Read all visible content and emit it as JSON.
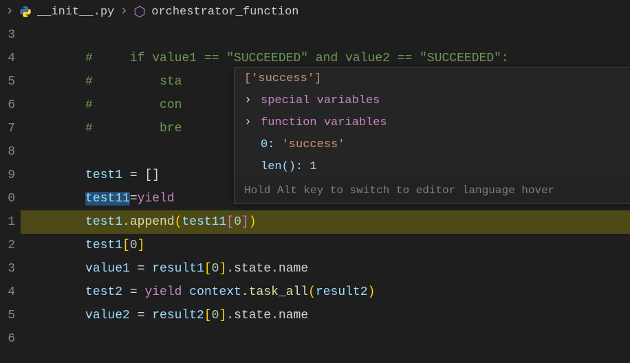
{
  "breadcrumb": {
    "file": "__init__.py",
    "symbol": "orchestrator_function"
  },
  "lines": {
    "l3": "",
    "l4_prefix": "#     ",
    "l4_code": "if value1 == \"SUCCEEDED\" and value2 == \"SUCCEEDED\":",
    "l5_prefix": "#         ",
    "l5_code": "sta",
    "l6_prefix": "#         ",
    "l6_code": "con",
    "l7_prefix": "#         ",
    "l7_code": "bre",
    "l8": "",
    "l9_var": "test1",
    "l9_rest": " = []",
    "l10_sel": "test11",
    "l10_eq": "=",
    "l10_kw": "yield ",
    "l11_a": "test1",
    "l11_dot": ".",
    "l11_fn": "append",
    "l11_po": "(",
    "l11_arg": "test11",
    "l11_bo": "[",
    "l11_idx": "0",
    "l11_bc": "]",
    "l11_pc": ")",
    "l12_var": "test1",
    "l12_bo": "[",
    "l12_idx": "0",
    "l12_bc": "]",
    "l13_var": "value1",
    "l13_eq": " = ",
    "l13_r": "result1",
    "l13_bo": "[",
    "l13_idx": "0",
    "l13_bc": "]",
    "l13_tail": ".state.name",
    "l14_var": "test2",
    "l14_eq": " = ",
    "l14_kw": "yield",
    "l14_sp": " ",
    "l14_ctx": "context",
    "l14_dot": ".",
    "l14_fn": "task_all",
    "l14_po": "(",
    "l14_arg": "result2",
    "l14_pc": ")",
    "l15_var": "value2",
    "l15_eq": " = ",
    "l15_r": "result2",
    "l15_bo": "[",
    "l15_idx": "0",
    "l15_bc": "]",
    "l15_tail": ".state.name"
  },
  "gutter": [
    "3",
    "4",
    "5",
    "6",
    "7",
    "8",
    "9",
    "0",
    "1",
    "2",
    "3",
    "4",
    "5",
    "6"
  ],
  "hover": {
    "header": "['success']",
    "item_special": "special variables",
    "item_function": "function variables",
    "idx_key": "0:",
    "idx_val": "'success'",
    "len_key": "len():",
    "len_val": "1",
    "hint": "Hold Alt key to switch to editor language hover"
  }
}
